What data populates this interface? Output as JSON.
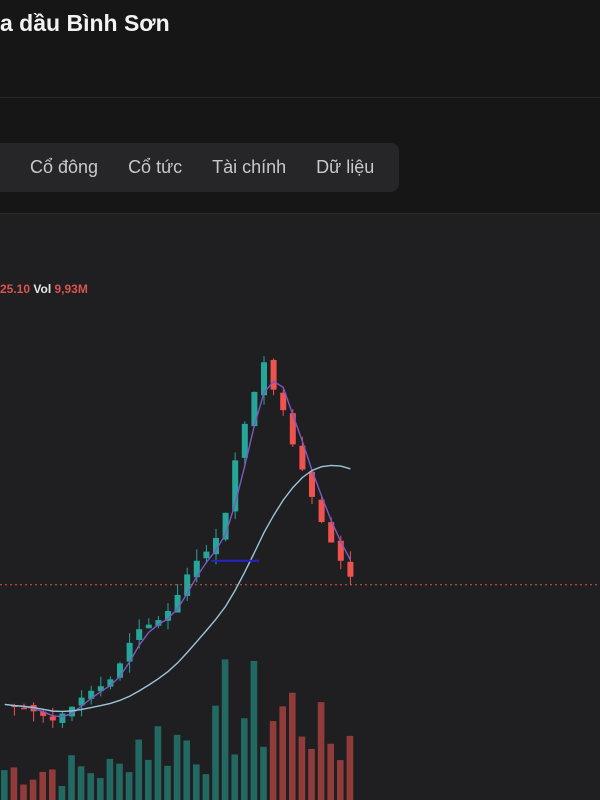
{
  "header": {
    "title": "a dầu Bình Sơn"
  },
  "tabs": [
    {
      "label": "Cổ đông"
    },
    {
      "label": "Cổ tức"
    },
    {
      "label": "Tài chính"
    },
    {
      "label": "Dữ liệu"
    }
  ],
  "legend": {
    "price": "25.10",
    "vol_label": "Vol",
    "vol_value": "9,93M"
  },
  "colors": {
    "up": "#26a69a",
    "down": "#ef5350",
    "ma_short": "#7e57c2",
    "ma_long": "#9bc4d8",
    "marker": "#2323c8",
    "price_line": "#d9534f"
  },
  "chart_data": {
    "type": "candlestick",
    "series": [
      {
        "values": [
          19.5,
          19.4,
          19.35,
          19.2,
          19.0,
          18.8,
          19.1,
          19.4,
          19.8,
          20.1,
          20.3,
          20.6,
          21.3,
          22.2,
          22.8,
          23.0,
          23.2,
          23.6,
          24.3,
          25.2,
          25.8,
          26.2,
          26.8,
          27.9,
          30.2,
          31.8,
          33.2,
          34.5,
          33.3,
          32.4,
          30.9,
          29.8,
          28.6,
          27.5,
          26.6,
          25.8,
          25.1
        ]
      }
    ]
  }
}
